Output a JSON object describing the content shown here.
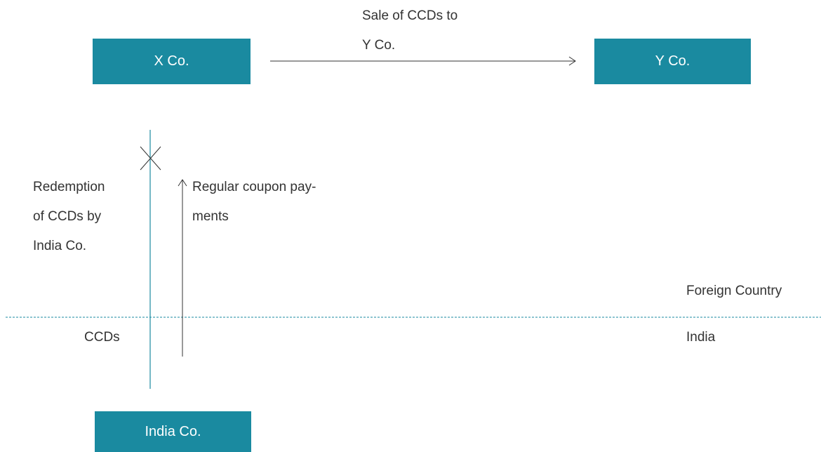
{
  "colors": {
    "box_fill": "#1a8aa0",
    "box_text": "#ffffff",
    "teal_line": "#1a8aa0",
    "arrow_line": "#333333",
    "text": "#333333"
  },
  "entities": {
    "x_co": "X Co.",
    "y_co": "Y Co.",
    "india_co": "India Co."
  },
  "flows": {
    "sale": [
      "Sale of CCDs to",
      "Y Co."
    ],
    "redemption": [
      "Redemption",
      "of CCDs by",
      "India Co."
    ],
    "coupon": [
      "Regular coupon pay-",
      "ments"
    ],
    "ccds": "CCDs"
  },
  "regions": {
    "foreign": "Foreign Country",
    "domestic": "India"
  }
}
